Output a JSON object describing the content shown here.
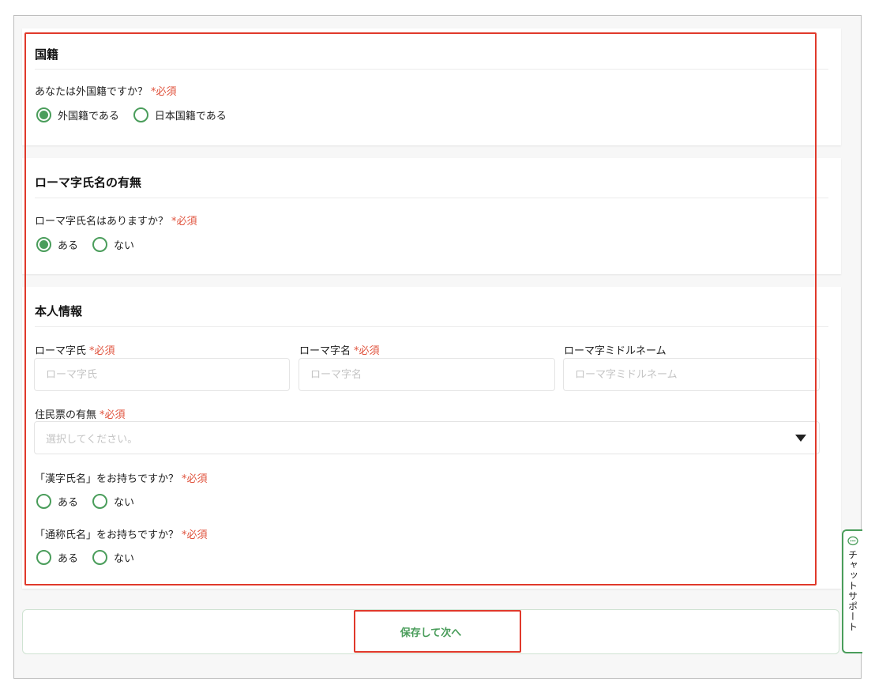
{
  "sections": {
    "nationality": {
      "title": "国籍",
      "question": "あなたは外国籍ですか？",
      "required": "*必須",
      "options": [
        "外国籍である",
        "日本国籍である"
      ],
      "selected": "外国籍である"
    },
    "roman_name": {
      "title": "ローマ字氏名の有無",
      "question": "ローマ字氏名はありますか？",
      "required": "*必須",
      "options": [
        "ある",
        "ない"
      ],
      "selected": "ある"
    },
    "personal_info": {
      "title": "本人情報",
      "fields": {
        "last_name": {
          "label": "ローマ字氏",
          "required": "*必須",
          "placeholder": "ローマ字氏",
          "value": ""
        },
        "first_name": {
          "label": "ローマ字名",
          "required": "*必須",
          "placeholder": "ローマ字名",
          "value": ""
        },
        "middle_name": {
          "label": "ローマ字ミドルネーム",
          "placeholder": "ローマ字ミドルネーム",
          "value": ""
        }
      },
      "resident_record": {
        "label": "住民票の有無",
        "required": "*必須",
        "placeholder": "選択してください。"
      },
      "kanji_name": {
        "question": "「漢字氏名」をお持ちですか？",
        "required": "*必須",
        "options": [
          "ある",
          "ない"
        ]
      },
      "alias_name": {
        "question": "「通称氏名」をお持ちですか？",
        "required": "*必須",
        "options": [
          "ある",
          "ない"
        ]
      }
    }
  },
  "submit": {
    "label": "保存して次へ"
  },
  "chat_support": {
    "label": "チャットサポート",
    "icon": "chat-bubble-icon"
  },
  "colors": {
    "accent": "#4a9d5b",
    "required": "#e0533d",
    "highlight": "#e0392b"
  }
}
